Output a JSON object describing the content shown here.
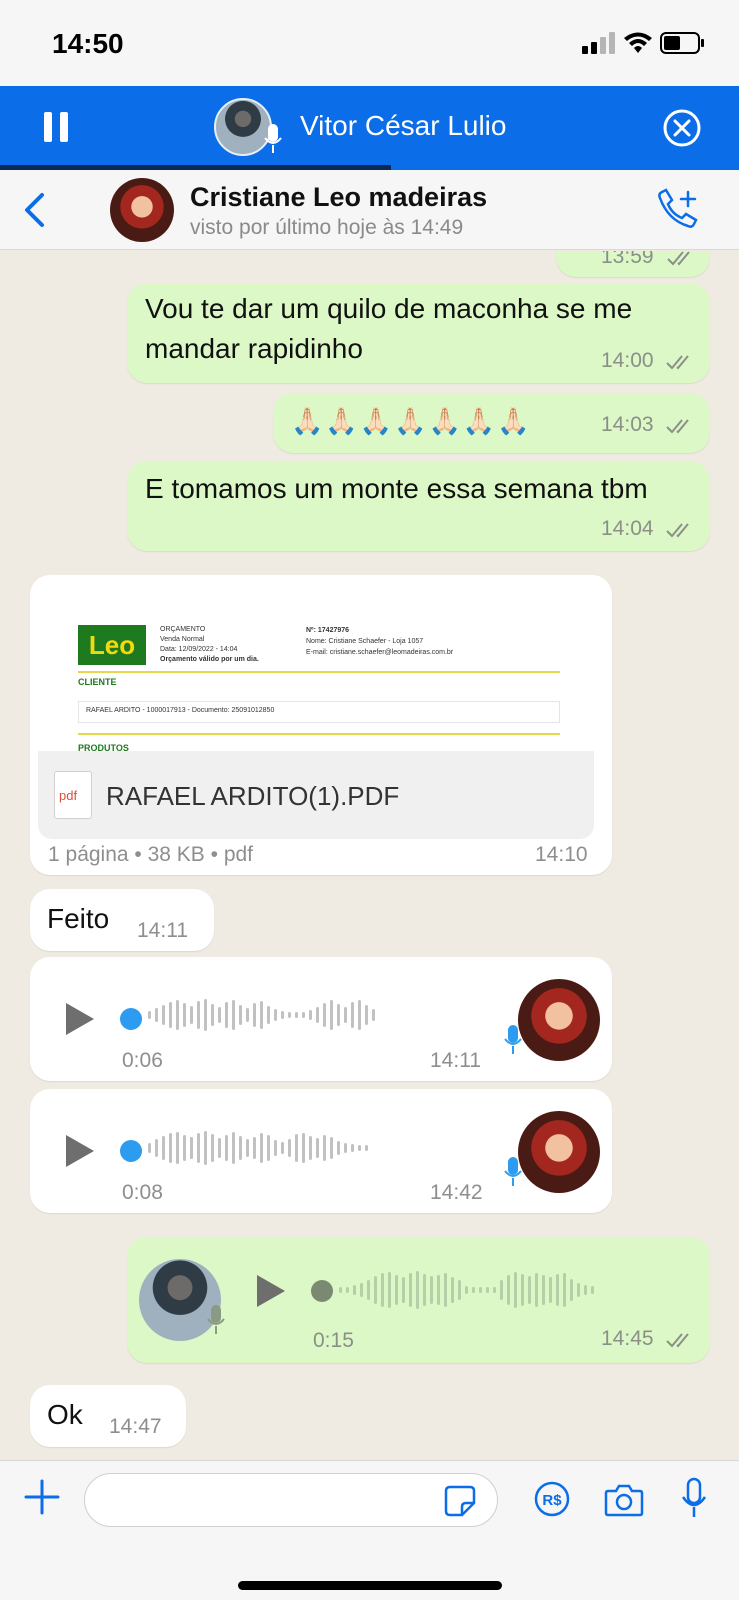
{
  "status_bar": {
    "time": "14:50"
  },
  "call_bar": {
    "caller_name": "Vitor César Lulio"
  },
  "header": {
    "contact_name": "Cristiane Leo madeiras",
    "last_seen": "visto por último hoje às 14:49"
  },
  "messages": [
    {
      "type": "text",
      "direction": "out",
      "time": "13:59",
      "text": ""
    },
    {
      "type": "text",
      "direction": "out",
      "time": "14:00",
      "lines": [
        "Vou te dar um quilo de maconha se me",
        "mandar rapidinho"
      ]
    },
    {
      "type": "emoji",
      "direction": "out",
      "time": "14:03",
      "text": "🙏🏻🙏🏻🙏🏻🙏🏻🙏🏻🙏🏻🙏🏻"
    },
    {
      "type": "text",
      "direction": "out",
      "time": "14:04",
      "text": "E tomamos um monte essa semana tbm"
    },
    {
      "type": "document",
      "direction": "in",
      "time": "14:10",
      "file_name": "RAFAEL ARDITO(1).PDF",
      "file_info": "1 página • 38 KB • pdf",
      "preview": {
        "logo": "Leo",
        "lines_left": [
          "ORÇAMENTO",
          "Venda Normal",
          "Data: 12/09/2022 - 14:04",
          "Orçamento válido por um dia."
        ],
        "lines_right": [
          "Nº: 17427976",
          "Nome: Cristiane Schaefer - Loja 1057",
          "E-mail: cristiane.schaefer@leomadeiras.com.br"
        ],
        "section_client": "CLIENTE",
        "client_line": "RAFAEL ARDITO - 1000017913 - Documento: 25091012850",
        "section_products": "PRODUTOS"
      }
    },
    {
      "type": "text",
      "direction": "in",
      "time": "14:11",
      "text": "Feito"
    },
    {
      "type": "audio",
      "direction": "in",
      "time": "14:11",
      "duration": "0:06"
    },
    {
      "type": "audio",
      "direction": "in",
      "time": "14:42",
      "duration": "0:08"
    },
    {
      "type": "audio",
      "direction": "out",
      "time": "14:45",
      "duration": "0:15"
    },
    {
      "type": "text",
      "direction": "in",
      "time": "14:47",
      "text": "Ok"
    }
  ],
  "icons": {
    "pause": "pause-icon",
    "close": "close-circle-icon",
    "back": "chevron-left-icon",
    "add_call": "phone-plus-icon",
    "plus": "plus-icon",
    "sticker": "sticker-icon",
    "payment": "payment-icon",
    "camera": "camera-icon",
    "mic": "microphone-icon"
  },
  "colors": {
    "call_bar": "#0b6ee8",
    "outgoing_bubble": "#dcf8c6",
    "incoming_bubble": "#ffffff",
    "accent": "#0b6ee8",
    "voice_dot": "#2d9cf0"
  }
}
